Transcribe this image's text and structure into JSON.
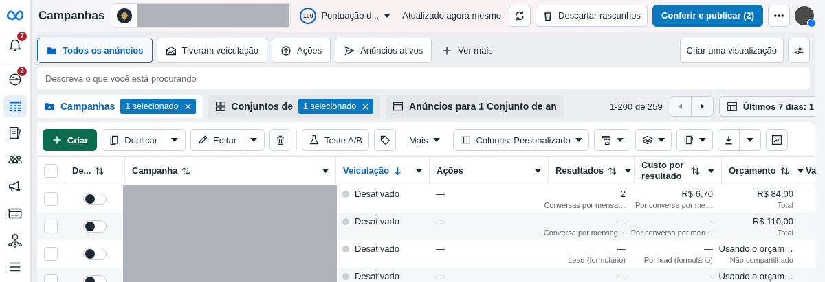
{
  "sidebar": {
    "items": [
      {
        "kind": "bell",
        "badge": "7",
        "selected": false
      },
      {
        "kind": "globe",
        "badge": "2",
        "selected": false
      },
      {
        "kind": "table",
        "selected": true
      },
      {
        "kind": "pages",
        "selected": false
      },
      {
        "kind": "people",
        "selected": false
      },
      {
        "kind": "megaphone",
        "selected": false
      },
      {
        "kind": "card",
        "selected": false
      },
      {
        "kind": "network",
        "selected": false
      },
      {
        "kind": "menu",
        "selected": false
      }
    ]
  },
  "header": {
    "title": "Campanhas",
    "score": "100",
    "score_label": "Pontuação d...",
    "updated": "Atualizado agora mesmo",
    "discard_button": "Descartar rascunhos",
    "publish_button": "Conferir e publicar (2)"
  },
  "filters": [
    {
      "kind": "folder",
      "label": "Todos os anúncios",
      "selected": true
    },
    {
      "kind": "envelope",
      "label": "Tiveram veiculação",
      "selected": false
    },
    {
      "kind": "upload",
      "label": "Ações",
      "selected": false
    },
    {
      "kind": "send",
      "label": "Anúncios ativos",
      "selected": false
    }
  ],
  "see_more": "Ver mais",
  "create_view_button": "Criar uma visualização",
  "search": {
    "placeholder": "Descreva o que você está procurando"
  },
  "tabs": [
    {
      "kind": "campaigns",
      "label": "Campanhas",
      "badge": "1 selecionado",
      "selected": true
    },
    {
      "kind": "adsets",
      "label": "Conjuntos de",
      "badge": "1 selecionado",
      "selected": false
    },
    {
      "kind": "ads",
      "label": "Anúncios para 1 Conjunto de an",
      "selected": false
    }
  ],
  "pagination": "1-200 de 259",
  "date_range": "Últimos 7 dias: 1",
  "toolbar": {
    "create": "Criar",
    "duplicate": "Duplicar",
    "edit": "Editar",
    "ab_test": "Teste A/B",
    "more": "Mais",
    "columns": "Colunas: Personalizado"
  },
  "table": {
    "select_all_checked": false,
    "columns": [
      {
        "label": "De...",
        "sorted": false
      },
      {
        "label": "Campanha",
        "sorted": false
      },
      {
        "label": "Veiculação",
        "sorted": true
      },
      {
        "label": "Ações",
        "sorted": false
      },
      {
        "label": "Resultados",
        "sorted": false
      },
      {
        "label": "Custo por resultado",
        "sorted": false
      },
      {
        "label": "Orçamento",
        "sorted": false
      },
      {
        "label": "Va",
        "sorted": false
      }
    ],
    "rows": [
      {
        "checked": false,
        "on": false,
        "delivery": "Desativado",
        "actions": "—",
        "results": "2",
        "results_sub": "Conversas por mensa…",
        "cost": "R$ 6,70",
        "cost_sub": "Por conversa por me…",
        "budget": "R$ 84,00",
        "budget_sub": "Total"
      },
      {
        "checked": false,
        "on": false,
        "delivery": "Desativado",
        "actions": "—",
        "results": "—",
        "results_sub": "Conversa por mensag…",
        "cost": "—",
        "cost_sub": "Por conversa por men…",
        "budget": "R$ 110,00",
        "budget_sub": "Total"
      },
      {
        "checked": false,
        "on": false,
        "delivery": "Desativado",
        "actions": "—",
        "results": "—",
        "results_sub": "Lead (formulário)",
        "cost": "—",
        "cost_sub": "Por lead (formulário)",
        "budget": "Usando o orçam…",
        "budget_sub": "Não compartilhado"
      },
      {
        "checked": false,
        "on": false,
        "delivery": "Desativado",
        "actions": "—",
        "results": "—",
        "cost": "—",
        "budget": "Usando o orçam…"
      }
    ]
  }
}
